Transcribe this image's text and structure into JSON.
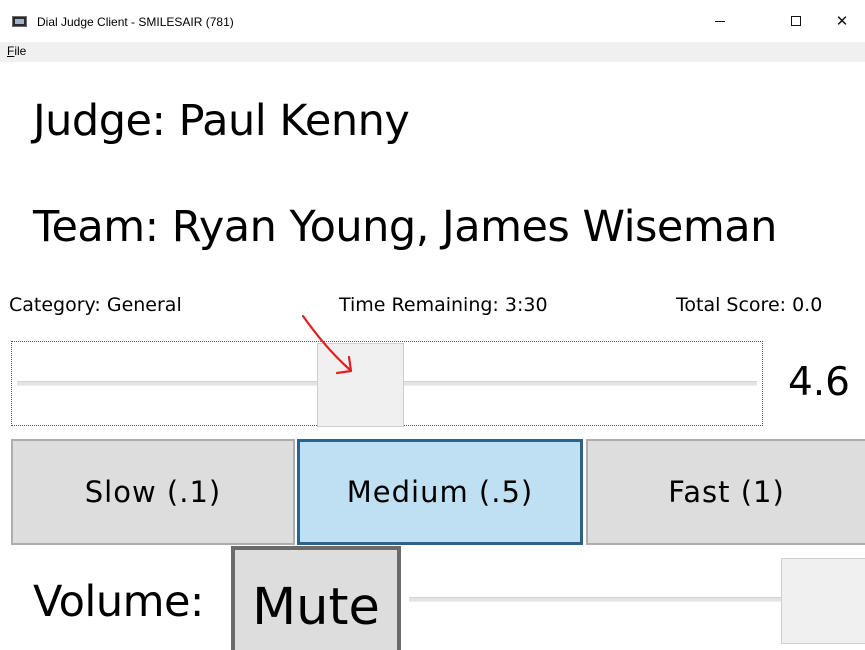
{
  "window": {
    "title": "Dial Judge Client - SMILESAIR (781)",
    "icon": "app-window-icon",
    "controls": {
      "minimize": "minimize-icon",
      "maximize": "maximize-icon",
      "close_glyph": "✕"
    }
  },
  "menu": {
    "file_label": "File"
  },
  "judge": {
    "text": "Judge: Paul Kenny"
  },
  "team": {
    "text": "Team: Ryan Young, James Wiseman"
  },
  "status": {
    "category": "Category: General",
    "time_remaining": "Time Remaining: 3:30",
    "total_score": "Total Score: 0.0"
  },
  "score_slider": {
    "value_label": "4.6"
  },
  "speed_buttons": {
    "slow": "Slow (.1)",
    "medium": "Medium (.5)",
    "fast": "Fast (1)",
    "selected": "medium"
  },
  "volume": {
    "label": "Volume:",
    "mute_label": "Mute"
  },
  "colors": {
    "selected_button_fill": "#bee0f2",
    "selected_button_border": "#2c628b",
    "button_fill": "#dddddd",
    "annotation_arrow": "#e02020"
  }
}
